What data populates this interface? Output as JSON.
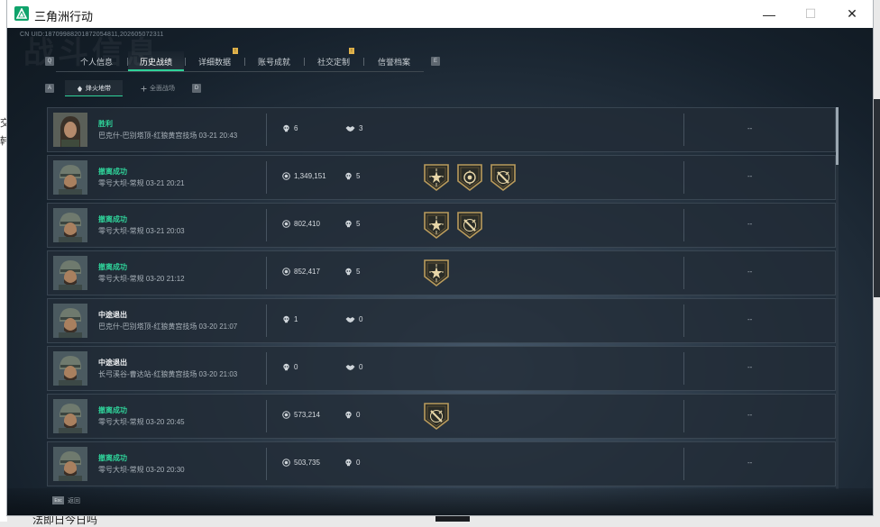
{
  "window": {
    "title": "三角洲行动",
    "min": "—",
    "max": "☐",
    "close": "✕"
  },
  "header": {
    "uid": "CN UID:18709988201872054811,202605072311",
    "watermark": "战斗信息"
  },
  "tabs": {
    "prev_key": "Q",
    "next_key": "E",
    "items": [
      {
        "label": "个人信息",
        "active": false
      },
      {
        "label": "历史战绩",
        "active": true
      },
      {
        "label": "详细数据",
        "active": false,
        "notify": "!"
      },
      {
        "label": "账号成就",
        "active": false,
        "notify": "!"
      },
      {
        "label": "社交定制",
        "active": false
      },
      {
        "label": "信誉档案",
        "active": false
      }
    ]
  },
  "subtabs": {
    "prev_key": "A",
    "next_key": "D",
    "items": [
      {
        "label": "烽火地带",
        "active": true
      },
      {
        "label": "全面战场",
        "active": false
      }
    ]
  },
  "records": [
    {
      "result": "胜利",
      "result_color": "green",
      "mode": "巴克什-巴别塔顶-红狼黄宫技场 03-21 20:43",
      "stat1_icon": "skull-icon",
      "stat1": "6",
      "stat2_icon": "handshake-icon",
      "stat2": "3",
      "badges": [],
      "extra": "--",
      "avatar": "long-hair"
    },
    {
      "result": "撤离成功",
      "result_color": "green",
      "mode": "零号大坝-常规 03-21 20:21",
      "stat1_icon": "coin-icon",
      "stat1": "1,349,151",
      "stat2_icon": "skull-icon",
      "stat2": "5",
      "badges": [
        "star-badge",
        "globe-badge",
        "slash-badge"
      ],
      "extra": "--",
      "avatar": "helmet"
    },
    {
      "result": "撤离成功",
      "result_color": "green",
      "mode": "零号大坝-常规 03-21 20:03",
      "stat1_icon": "coin-icon",
      "stat1": "802,410",
      "stat2_icon": "skull-icon",
      "stat2": "5",
      "badges": [
        "star-badge",
        "slash-badge"
      ],
      "extra": "--",
      "avatar": "helmet"
    },
    {
      "result": "撤离成功",
      "result_color": "green",
      "mode": "零号大坝-常规 03-20 21:12",
      "stat1_icon": "coin-icon",
      "stat1": "852,417",
      "stat2_icon": "skull-icon",
      "stat2": "5",
      "badges": [
        "star-badge"
      ],
      "extra": "--",
      "avatar": "helmet"
    },
    {
      "result": "中途退出",
      "result_color": "white",
      "mode": "巴克什-巴别塔顶-红狼黄宫技场 03-20 21:07",
      "stat1_icon": "skull-icon",
      "stat1": "1",
      "stat2_icon": "handshake-icon",
      "stat2": "0",
      "badges": [],
      "extra": "--",
      "avatar": "helmet"
    },
    {
      "result": "中途退出",
      "result_color": "white",
      "mode": "长弓溪谷-曹达站-红狼黄宫技场 03-20 21:03",
      "stat1_icon": "skull-icon",
      "stat1": "0",
      "stat2_icon": "handshake-icon",
      "stat2": "0",
      "badges": [],
      "extra": "--",
      "avatar": "helmet"
    },
    {
      "result": "撤离成功",
      "result_color": "green",
      "mode": "零号大坝-常规 03-20 20:45",
      "stat1_icon": "coin-icon",
      "stat1": "573,214",
      "stat2_icon": "skull-icon",
      "stat2": "0",
      "badges": [
        "slash-badge"
      ],
      "extra": "--",
      "avatar": "helmet"
    },
    {
      "result": "撤离成功",
      "result_color": "green",
      "mode": "零号大坝-常规 03-20 20:30",
      "stat1_icon": "coin-icon",
      "stat1": "503,735",
      "stat2_icon": "skull-icon",
      "stat2": "0",
      "badges": [],
      "extra": "--",
      "avatar": "helmet"
    }
  ],
  "footer": {
    "key": "Esc",
    "label": "返回"
  },
  "background": {
    "left_texts": [
      "交",
      "韩"
    ],
    "bottom_text": "法即日今日吗"
  },
  "colors": {
    "accent": "#2fd39a",
    "notify": "#e0b24b"
  }
}
